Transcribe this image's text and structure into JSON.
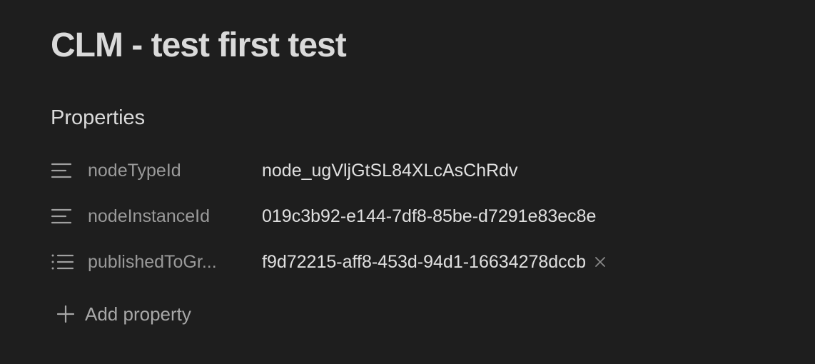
{
  "note": {
    "title": "CLM - test first test"
  },
  "properties": {
    "heading": "Properties",
    "items": [
      {
        "icon": "text-lines-icon",
        "key": "nodeTypeId",
        "value": "node_ugVljGtSL84XLcAsChRdv"
      },
      {
        "icon": "text-lines-icon",
        "key": "nodeInstanceId",
        "value": "019c3b92-e144-7df8-85be-d7291e83ec8e"
      },
      {
        "icon": "list-icon",
        "key": "publishedToGr...",
        "value": "f9d72215-aff8-453d-94d1-16634278dccb",
        "remove_icon": "close-icon"
      }
    ],
    "add_label": "Add property",
    "add_icon": "plus-icon"
  },
  "colors": {
    "background": "#1e1e1e",
    "title_text": "#dadada",
    "key_text": "#9a9a9a",
    "value_text": "#e0e0e0",
    "icon": "#a0a0a0"
  }
}
